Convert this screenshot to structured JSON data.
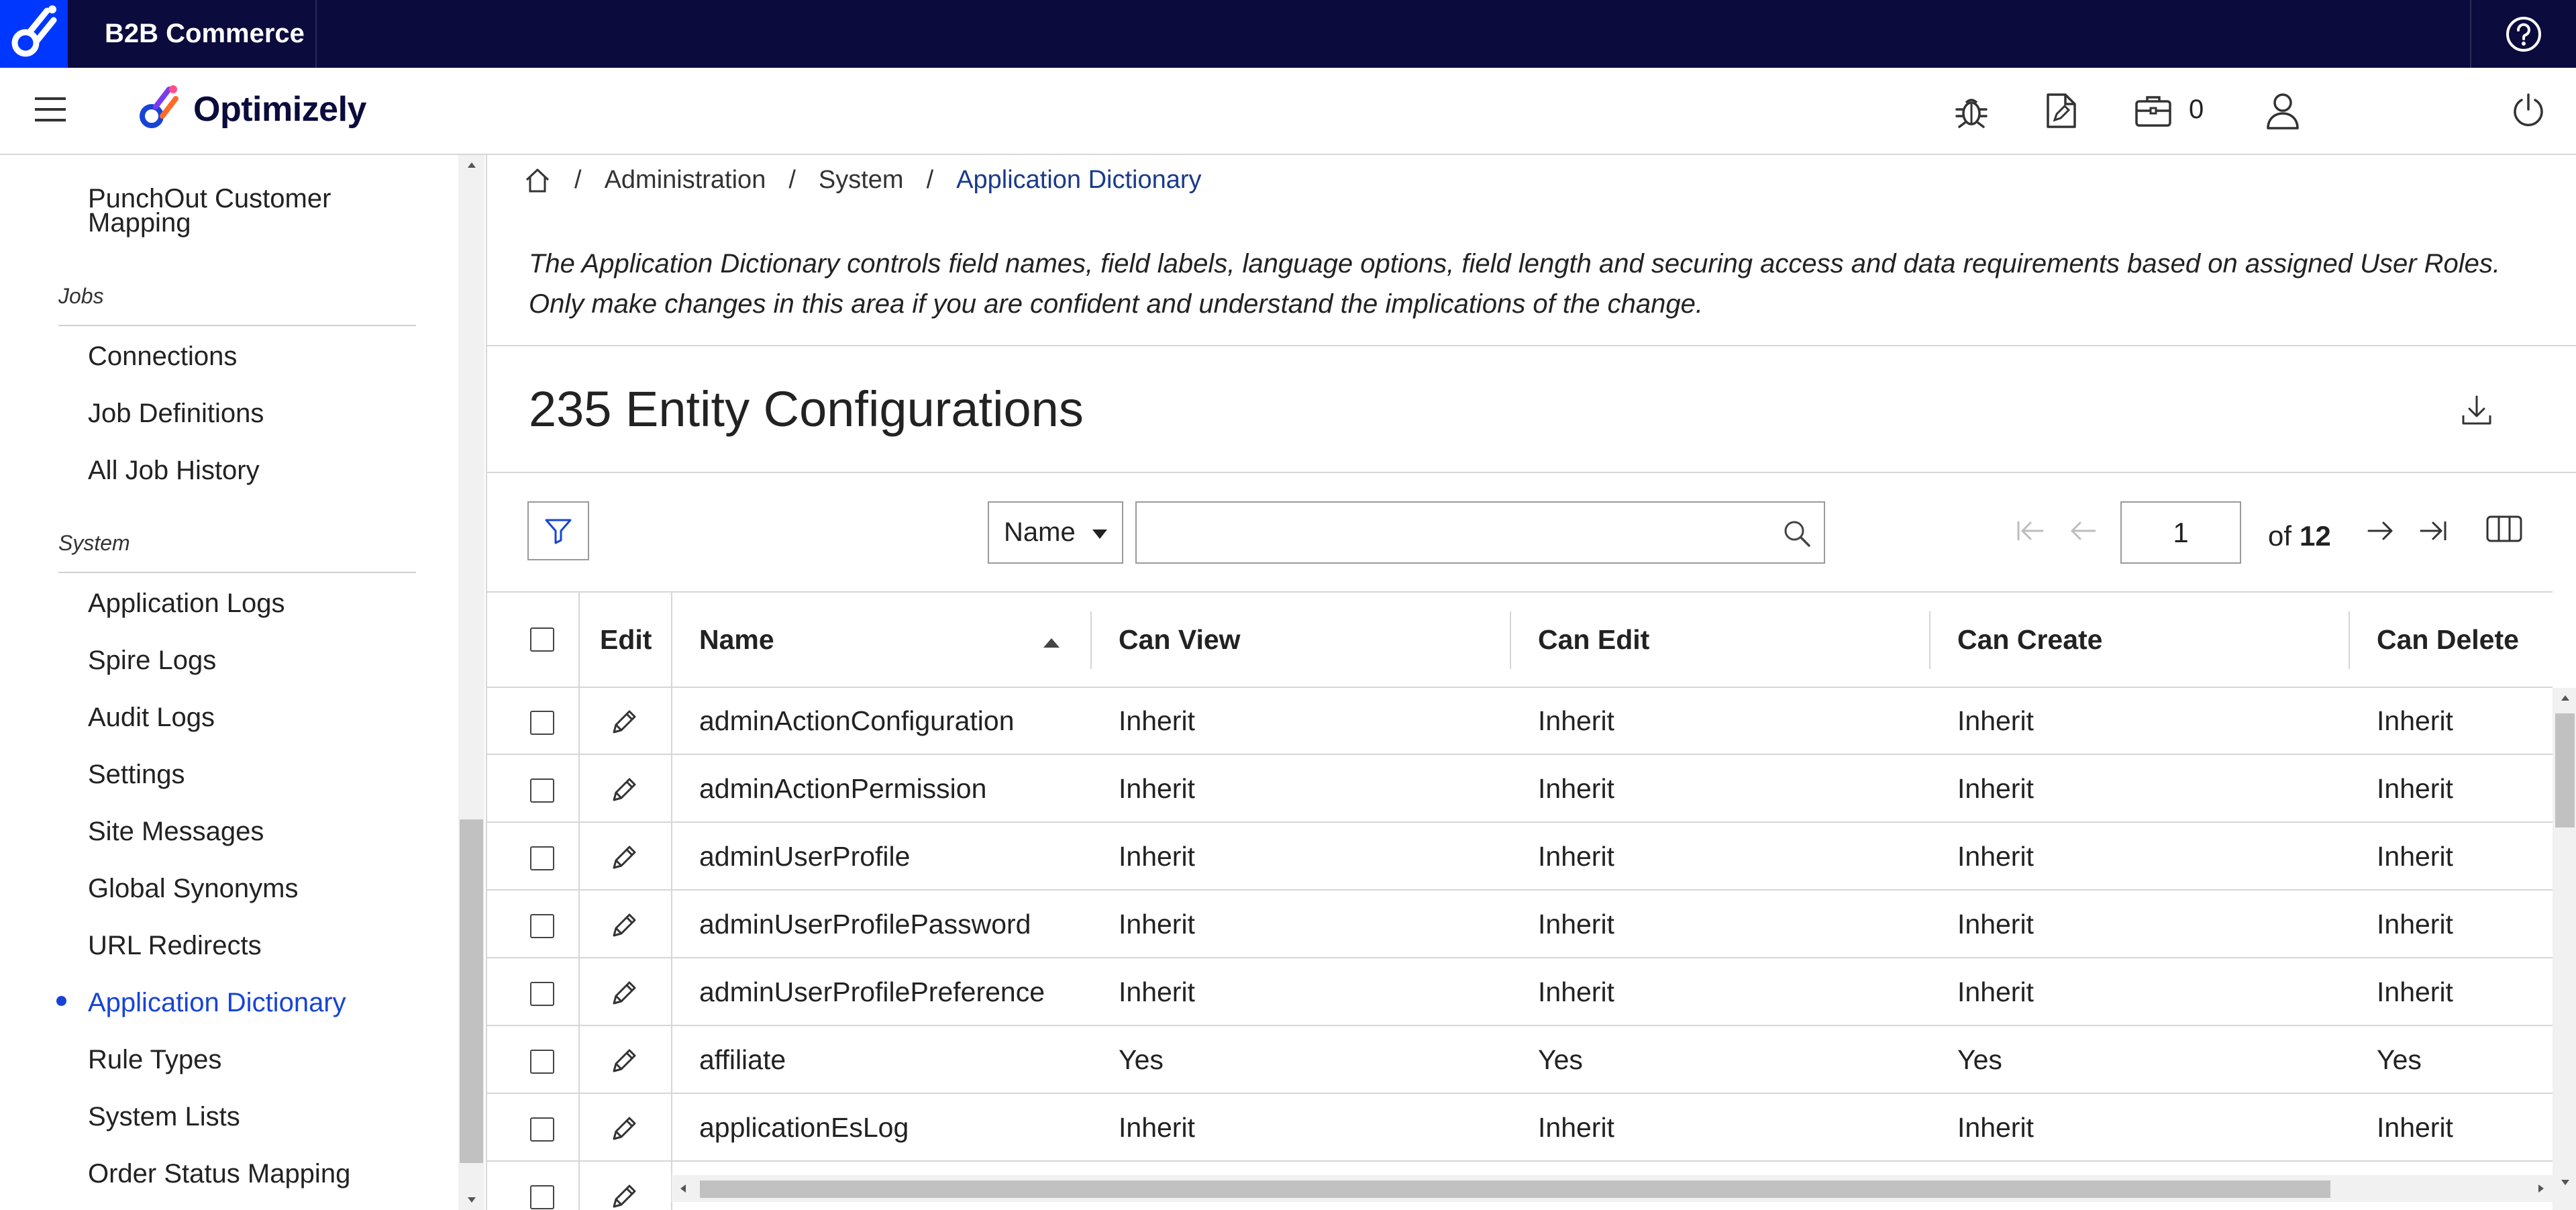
{
  "topbar": {
    "app_name": "B2B Commerce"
  },
  "header": {
    "brand": "Optimizely",
    "cart_count": "0"
  },
  "sidebar": {
    "items": [
      {
        "label": "PunchOut Customer Mapping",
        "active": false
      },
      {
        "heading": "Jobs"
      },
      {
        "label": "Connections",
        "active": false
      },
      {
        "label": "Job Definitions",
        "active": false
      },
      {
        "label": "All Job History",
        "active": false
      },
      {
        "heading": "System"
      },
      {
        "label": "Application Logs",
        "active": false
      },
      {
        "label": "Spire Logs",
        "active": false
      },
      {
        "label": "Audit Logs",
        "active": false
      },
      {
        "label": "Settings",
        "active": false
      },
      {
        "label": "Site Messages",
        "active": false
      },
      {
        "label": "Global Synonyms",
        "active": false
      },
      {
        "label": "URL Redirects",
        "active": false
      },
      {
        "label": "Application Dictionary",
        "active": true
      },
      {
        "label": "Rule Types",
        "active": false
      },
      {
        "label": "System Lists",
        "active": false
      },
      {
        "label": "Order Status Mapping",
        "active": false
      }
    ]
  },
  "breadcrumb": {
    "items": [
      "Administration",
      "System"
    ],
    "current": "Application Dictionary",
    "separator": "/"
  },
  "description": "The Application Dictionary controls field names, field labels, language options, field length and securing access and data requirements based on assigned User Roles. Only make changes in this area if you are confident and understand the implications of the change.",
  "page_title": "235 Entity Configurations",
  "toolbar": {
    "search_field_selected": "Name",
    "search_value": "",
    "page_current": "1",
    "of_word": "of",
    "page_total": "12"
  },
  "table": {
    "columns": [
      "Edit",
      "Name",
      "Can View",
      "Can Edit",
      "Can Create",
      "Can Delete"
    ],
    "sort": {
      "column": "Name",
      "direction": "ascending"
    },
    "rows": [
      [
        "adminActionConfiguration",
        "Inherit",
        "Inherit",
        "Inherit",
        "Inherit"
      ],
      [
        "adminActionPermission",
        "Inherit",
        "Inherit",
        "Inherit",
        "Inherit"
      ],
      [
        "adminUserProfile",
        "Inherit",
        "Inherit",
        "Inherit",
        "Inherit"
      ],
      [
        "adminUserProfilePassword",
        "Inherit",
        "Inherit",
        "Inherit",
        "Inherit"
      ],
      [
        "adminUserProfilePreference",
        "Inherit",
        "Inherit",
        "Inherit",
        "Inherit"
      ],
      [
        "affiliate",
        "Yes",
        "Yes",
        "Yes",
        "Yes"
      ],
      [
        "applicationEsLog",
        "Inherit",
        "Inherit",
        "Inherit",
        "Inherit"
      ],
      [
        "",
        "",
        "",
        "",
        ""
      ]
    ]
  },
  "colors": {
    "topbar": "#0b0b3d",
    "logo_bg": "#0037ff",
    "accent": "#1744d6",
    "breadcrumb_current": "#1a3a8a"
  },
  "icons": [
    "optimizely-logo-icon",
    "help-icon",
    "hamburger-icon",
    "bug-icon",
    "document-edit-icon",
    "briefcase-icon",
    "user-icon",
    "power-icon",
    "home-icon",
    "download-icon",
    "filter-icon",
    "search-icon",
    "first-page-icon",
    "prev-page-icon",
    "next-page-icon",
    "last-page-icon",
    "columns-icon",
    "pencil-icon"
  ]
}
